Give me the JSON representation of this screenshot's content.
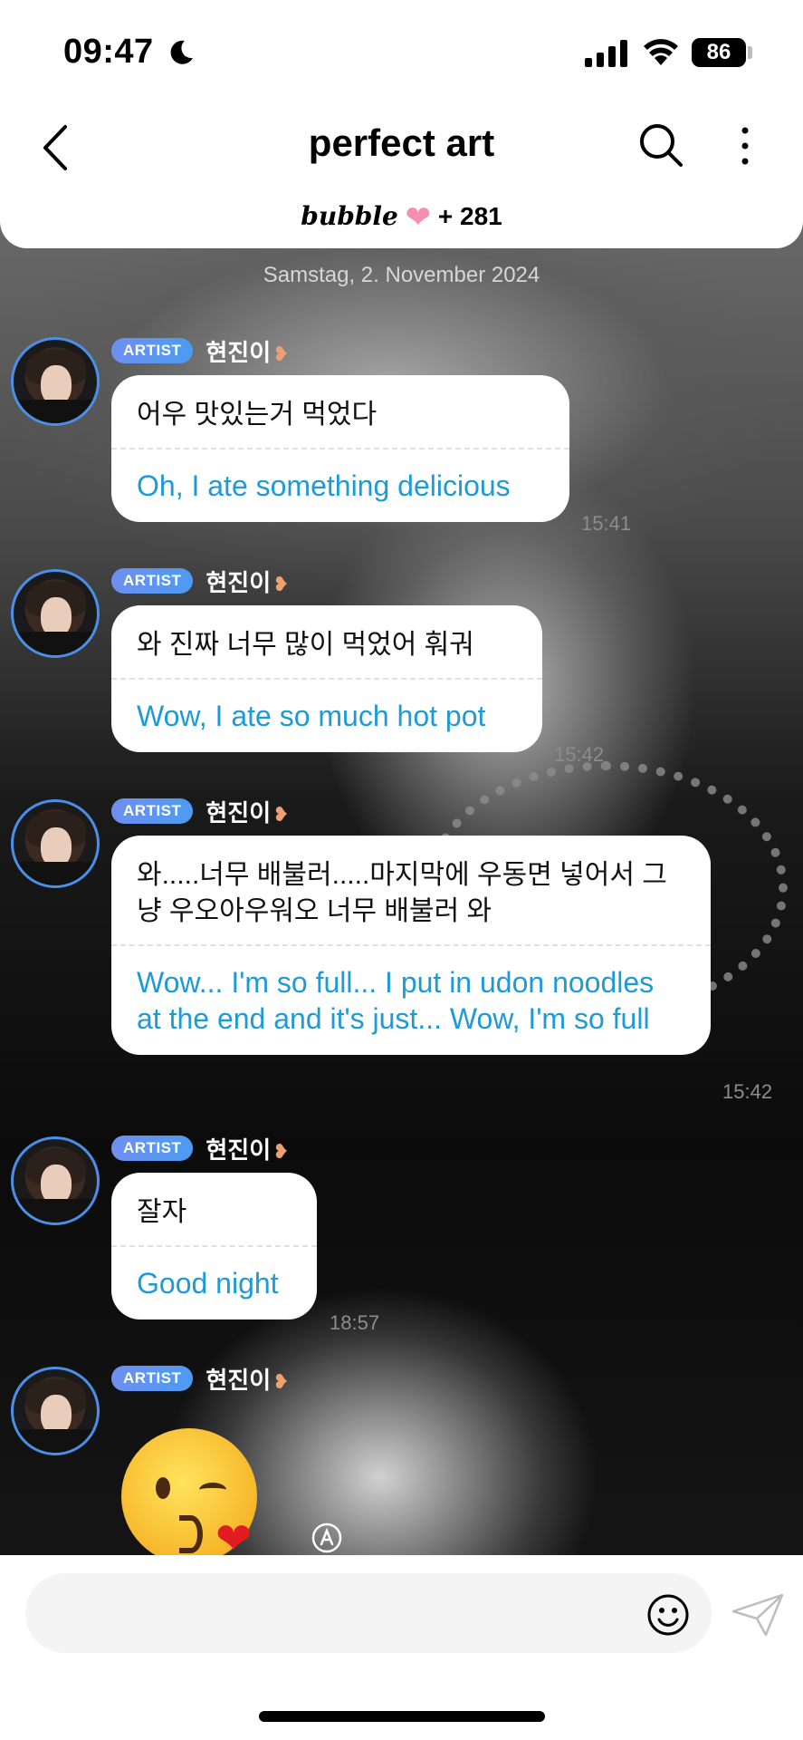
{
  "status_bar": {
    "time": "09:47",
    "battery": "86"
  },
  "header": {
    "title": "perfect art",
    "subtitle_brand": "bubble",
    "subtitle_count": "+ 281"
  },
  "chat": {
    "date": "Samstag, 2. November 2024",
    "messages": [
      {
        "badge": "ARTIST",
        "sender": "현진이",
        "korean": "어우 맛있는거 먹었다",
        "translation": "Oh, I ate something delicious",
        "time": "15:41"
      },
      {
        "badge": "ARTIST",
        "sender": "현진이",
        "korean": "와 진짜 너무 많이 먹었어 훠궈",
        "translation": "Wow, I ate so much hot pot",
        "time": "15:42"
      },
      {
        "badge": "ARTIST",
        "sender": "현진이",
        "korean": "와.....너무 배불러.....마지막에 우동면 넣어서 그냥 우오아우워오 너무 배불러 와",
        "translation": "Wow... I'm so full... I put in udon noodles at the end and it's just... Wow, I'm so full",
        "time": "15:42"
      },
      {
        "badge": "ARTIST",
        "sender": "현진이",
        "korean": "잘자",
        "translation": "Good night",
        "time": "18:57"
      },
      {
        "badge": "ARTIST",
        "sender": "현진이",
        "emoji": "kissing-heart-emoji"
      }
    ]
  },
  "composer": {
    "placeholder": ""
  },
  "colors": {
    "accent_blue": "#1e9ad6",
    "badge_blue": "#5a95f0",
    "avatar_ring": "#4a8fe8",
    "heart_pink": "#f48fb1"
  }
}
